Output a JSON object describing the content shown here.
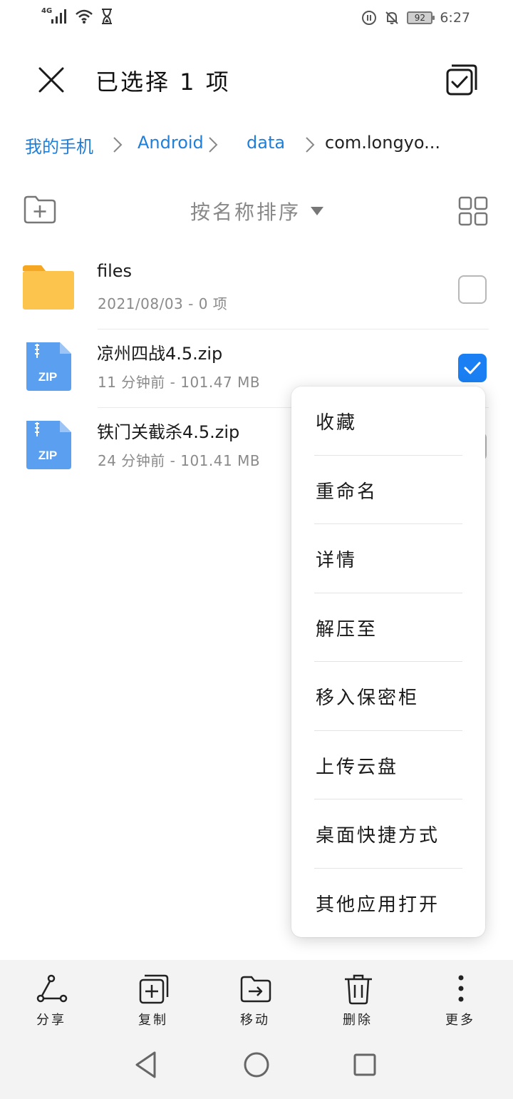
{
  "status_bar": {
    "network": "4G",
    "time": "6:27",
    "battery": "92",
    "icons": [
      "signal-icon",
      "wifi-icon",
      "hourglass-icon",
      "data-saver-icon",
      "mute-icon",
      "battery-icon"
    ]
  },
  "header": {
    "title": "已选择 1 项",
    "close_icon": "close-icon",
    "select_all_icon": "select-all-icon"
  },
  "breadcrumb": [
    {
      "label": "我的手机"
    },
    {
      "label": "Android"
    },
    {
      "label": "data"
    },
    {
      "label": "com.longyo..."
    }
  ],
  "toolbar": {
    "sort_label": "按名称排序",
    "new_folder_icon": "new-folder-icon",
    "grid_view_icon": "grid-view-icon"
  },
  "files": [
    {
      "name": "files",
      "meta": "2021/08/03 - 0 项",
      "type": "folder",
      "checked": false
    },
    {
      "name": "凉州四战4.5.zip",
      "meta": "11 分钟前 - 101.47 MB",
      "type": "zip",
      "checked": true
    },
    {
      "name": "铁门关截杀4.5.zip",
      "meta": "24 分钟前 - 101.41 MB",
      "type": "zip",
      "checked": false
    }
  ],
  "file_icon_label": "ZIP",
  "menu": [
    {
      "label": "收藏"
    },
    {
      "label": "重命名"
    },
    {
      "label": "详情"
    },
    {
      "label": "解压至"
    },
    {
      "label": "移入保密柜"
    },
    {
      "label": "上传云盘"
    },
    {
      "label": "桌面快捷方式"
    },
    {
      "label": "其他应用打开"
    }
  ],
  "actions": [
    {
      "label": "分享",
      "icon": "share-icon"
    },
    {
      "label": "复制",
      "icon": "copy-icon"
    },
    {
      "label": "移动",
      "icon": "move-icon"
    },
    {
      "label": "删除",
      "icon": "delete-icon"
    },
    {
      "label": "更多",
      "icon": "more-icon"
    }
  ],
  "colors": {
    "accent": "#1a7ff2",
    "link": "#1f7fd8",
    "folder": "#fcc44c",
    "zip": "#5a9ff0"
  }
}
